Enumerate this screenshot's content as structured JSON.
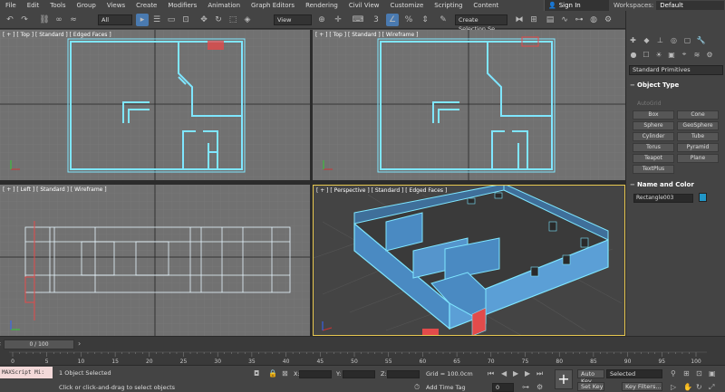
{
  "menubar": {
    "items": [
      "File",
      "Edit",
      "Tools",
      "Group",
      "Views",
      "Create",
      "Modifiers",
      "Animation",
      "Graph Editors",
      "Rendering",
      "Civil View",
      "Customize",
      "Scripting",
      "Content"
    ],
    "signin": "Sign In",
    "workspaces_label": "Workspaces:",
    "workspaces_value": "Default"
  },
  "toolbar": {
    "selection_filter": "All",
    "reference_coord": "View",
    "named_selection": "Create Selection Se"
  },
  "viewports": {
    "top_edged": "[ + ] [ Top ] [ Standard ] [ Edged Faces ]",
    "top_wire": "[ + ] [ Top ] [ Standard ] [ Wireframe ]",
    "left_wire": "[ + ] [ Left ] [ Standard ] [ Wireframe ]",
    "perspective": "[ + ] [ Perspective ] [ Standard ] [ Edged Faces ]"
  },
  "command_panel": {
    "dropdown": "Standard Primitives",
    "object_type_header": "Object Type",
    "autogrid": "AutoGrid",
    "primitives": [
      "Box",
      "Cone",
      "Sphere",
      "GeoSphere",
      "Cylinder",
      "Tube",
      "Torus",
      "Pyramid",
      "Teapot",
      "Plane",
      "TextPlus"
    ],
    "name_color_header": "Name and Color",
    "object_name": "Rectangle003"
  },
  "timeline": {
    "frame_display": "0 / 100",
    "ticks": [
      "0",
      "5",
      "10",
      "15",
      "20",
      "25",
      "30",
      "35",
      "40",
      "45",
      "50",
      "55",
      "60",
      "65",
      "70",
      "75",
      "80",
      "85",
      "90",
      "95",
      "100"
    ]
  },
  "status": {
    "maxscript": "MAXScript Mi:",
    "selected": "1 Object Selected",
    "prompt": "Click or click-and-drag to select objects",
    "x_label": "X:",
    "y_label": "Y:",
    "z_label": "Z:",
    "grid": "Grid = 100.0cm",
    "add_time_tag": "Add Time Tag",
    "auto_key": "Auto Key",
    "set_key": "Set Key",
    "selected_dropdown": "Selected",
    "key_filters": "Key Filters...",
    "frame_value": "0"
  }
}
